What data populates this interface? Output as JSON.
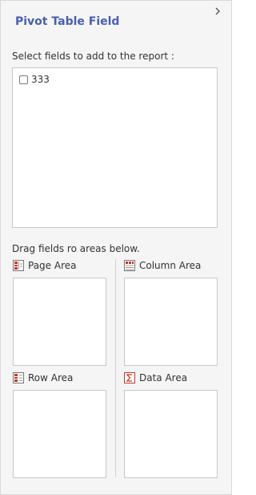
{
  "panel": {
    "title": "Pivot Table Field",
    "collapse_icon": "chevron-right-icon"
  },
  "fields": {
    "prompt": "Select fields to add to the report :",
    "items": [
      {
        "label": "333",
        "checked": false
      }
    ]
  },
  "areas": {
    "prompt": "Drag fields ro areas below.",
    "page": {
      "label": "Page Area",
      "icon": "page-area-icon"
    },
    "column": {
      "label": "Column Area",
      "icon": "column-area-icon"
    },
    "row": {
      "label": "Row Area",
      "icon": "row-area-icon"
    },
    "data": {
      "label": "Data Area",
      "icon": "sigma-icon"
    }
  },
  "colors": {
    "title": "#4a5fb0",
    "icon_red": "#c0392b"
  }
}
